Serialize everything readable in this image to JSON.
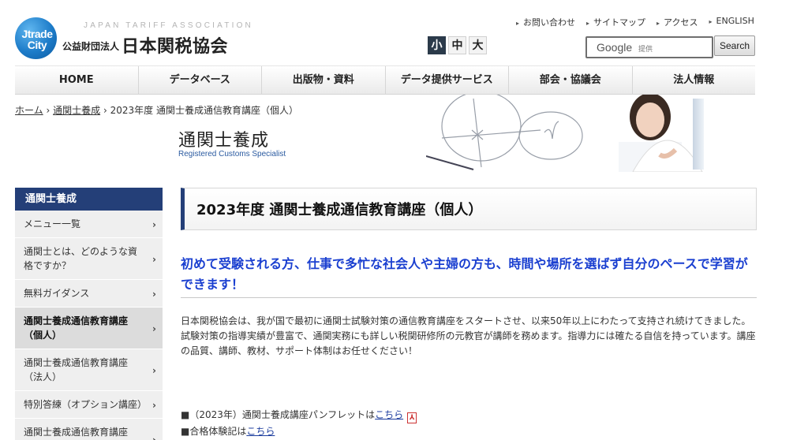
{
  "header": {
    "logo_mark": "Jtrade City",
    "logo_sub": "JAPAN TARIFF ASSOCIATION",
    "org_prefix": "公益財団法人",
    "org_name": "日本関税協会",
    "utility_links": [
      "お問い合わせ",
      "サイトマップ",
      "アクセス",
      "ENGLISH"
    ],
    "font_sizes": [
      "小",
      "中",
      "大"
    ],
    "font_size_selected": "小",
    "search": {
      "brand": "Google",
      "hint": "提供",
      "button": "Search"
    }
  },
  "nav": [
    "HOME",
    "データベース",
    "出版物・資料",
    "データ提供サービス",
    "部会・協議会",
    "法人情報"
  ],
  "breadcrumb": {
    "home": "ホーム",
    "section": "通関士養成",
    "current": "2023年度 通関士養成通信教育講座（個人）",
    "separator": "›"
  },
  "banner": {
    "title": "通関士養成",
    "subtitle": "Registered Customs Specialist"
  },
  "sidebar": {
    "heading": "通関士養成",
    "items": [
      {
        "label": "メニュー一覧"
      },
      {
        "label": "通関士とは、どのような資格ですか？"
      },
      {
        "label": "無料ガイダンス"
      },
      {
        "label": "通関士養成通信教育講座（個人）",
        "active": true
      },
      {
        "label": "通関士養成通信教育講座（法人）"
      },
      {
        "label": "特別答練（オプション講座）"
      },
      {
        "label": "通関士養成通信教育講座（料金）"
      }
    ]
  },
  "main": {
    "title": "2023年度 通関士養成通信教育講座（個人）",
    "lead": "初めて受験される方、仕事で多忙な社会人や主婦の方も、時間や場所を選ばず自分のペースで学習ができます！",
    "body": [
      "日本関税協会は、我が国で最初に通関士試験対策の通信教育講座をスタートさせ、以来50年以上にわたって支持され続けてきました。",
      "試験対策の指導実績が豊富で、通関実務にも詳しい税関研修所の元教官が講師を務めます。指導力には確たる自信を持っています。講座の品質、講師、教材、サポート体制はお任せください！"
    ],
    "links": [
      {
        "prefix": "■（2023年）通関士養成講座パンフレットは",
        "link": "こちら",
        "icon": "pdf-icon"
      },
      {
        "prefix": "■合格体験記は",
        "link": "こちら"
      }
    ]
  },
  "colors": {
    "brand_navy": "#243f78",
    "lead_blue": "#1a3fd0",
    "link": "#1c3d9e"
  }
}
